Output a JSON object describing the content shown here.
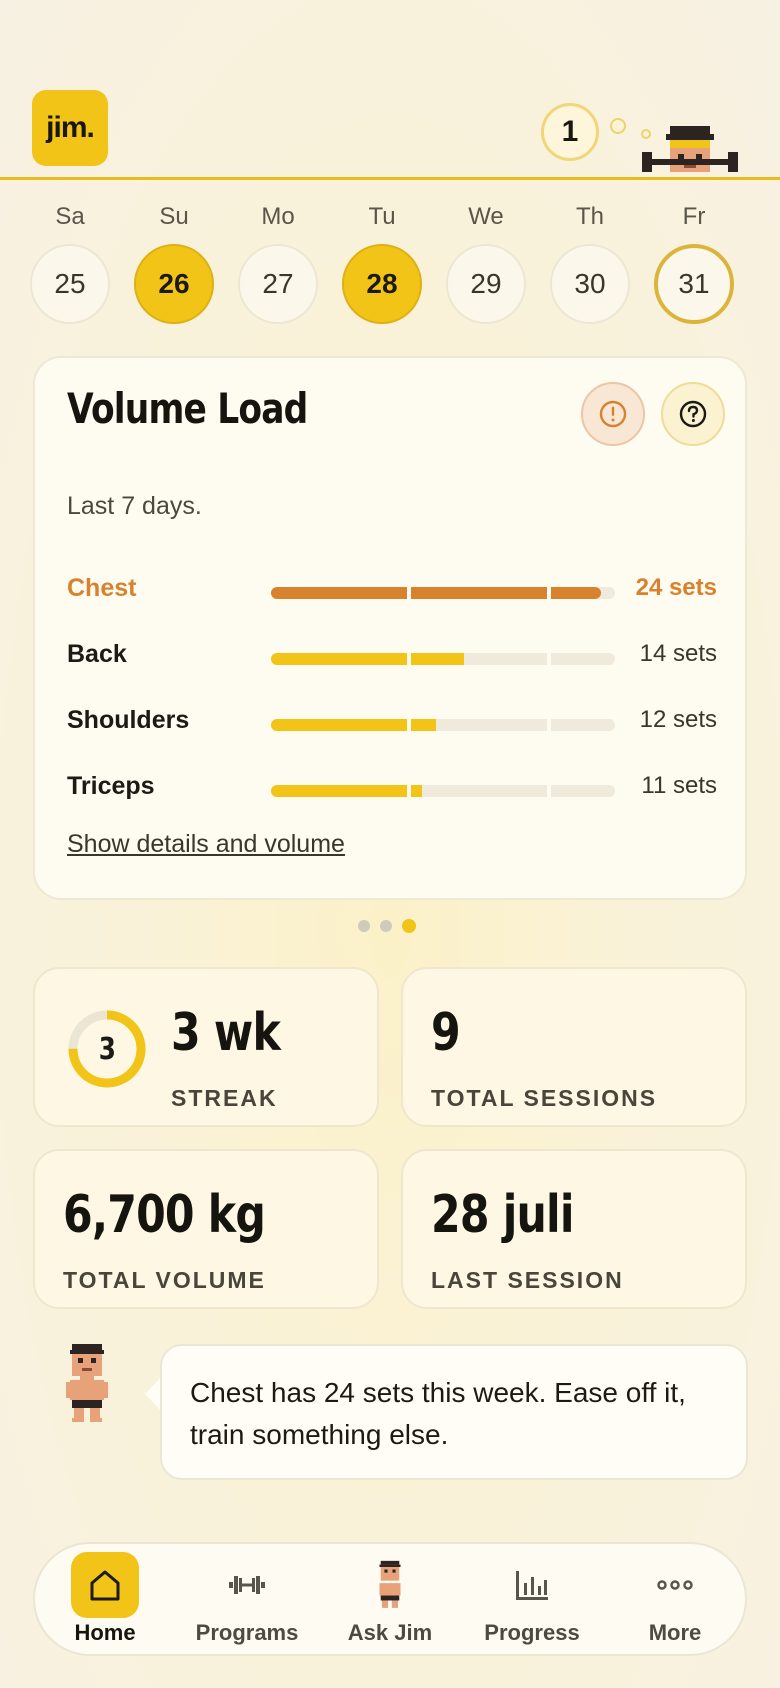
{
  "header": {
    "logo_text": "jim.",
    "notification_count": "1"
  },
  "week": {
    "days": [
      {
        "label": "Sa",
        "date": "25",
        "state": "none"
      },
      {
        "label": "Su",
        "date": "26",
        "state": "trained"
      },
      {
        "label": "Mo",
        "date": "27",
        "state": "none"
      },
      {
        "label": "Tu",
        "date": "28",
        "state": "trained"
      },
      {
        "label": "We",
        "date": "29",
        "state": "none"
      },
      {
        "label": "Th",
        "date": "30",
        "state": "none"
      },
      {
        "label": "Fr",
        "date": "31",
        "state": "today"
      }
    ]
  },
  "volume_card": {
    "title": "Volume Load",
    "subtitle": "Last 7 days.",
    "warning_icon": "alert-circle-icon",
    "help_icon": "question-circle-icon",
    "max_sets_scale": 25,
    "rows": [
      {
        "name": "Chest",
        "sets": "24 sets",
        "value": 24,
        "status": "warning",
        "color": "#d9822e"
      },
      {
        "name": "Back",
        "sets": "14 sets",
        "value": 14,
        "status": "normal",
        "color": "#f2c418"
      },
      {
        "name": "Shoulders",
        "sets": "12 sets",
        "value": 12,
        "status": "normal",
        "color": "#f2c418"
      },
      {
        "name": "Triceps",
        "sets": "11 sets",
        "value": 11,
        "status": "normal",
        "color": "#f2c418"
      }
    ],
    "details_link": "Show details and volume",
    "pager": {
      "total": 3,
      "active": 3
    }
  },
  "stats": {
    "streak": {
      "ring_number": "3",
      "value": "3 wk",
      "label": "STREAK",
      "ring_progress": 0.75
    },
    "sessions": {
      "value": "9",
      "label": "TOTAL SESSIONS"
    },
    "volume": {
      "value": "6,700 kg",
      "label": "TOTAL VOLUME"
    },
    "last": {
      "value": "28 juli",
      "label": "LAST SESSION"
    }
  },
  "coach": {
    "message": "Chest has 24 sets this week. Ease off it, train something else."
  },
  "nav": {
    "items": [
      {
        "label": "Home",
        "icon": "home-icon",
        "active": true
      },
      {
        "label": "Programs",
        "icon": "dumbbell-icon",
        "active": false
      },
      {
        "label": "Ask Jim",
        "icon": "jim-avatar-icon",
        "active": false
      },
      {
        "label": "Progress",
        "icon": "bar-chart-icon",
        "active": false
      },
      {
        "label": "More",
        "icon": "more-dots-icon",
        "active": false
      }
    ]
  },
  "colors": {
    "accent": "#f2c418",
    "warning": "#d9822e",
    "background": "#f9f2d8"
  }
}
